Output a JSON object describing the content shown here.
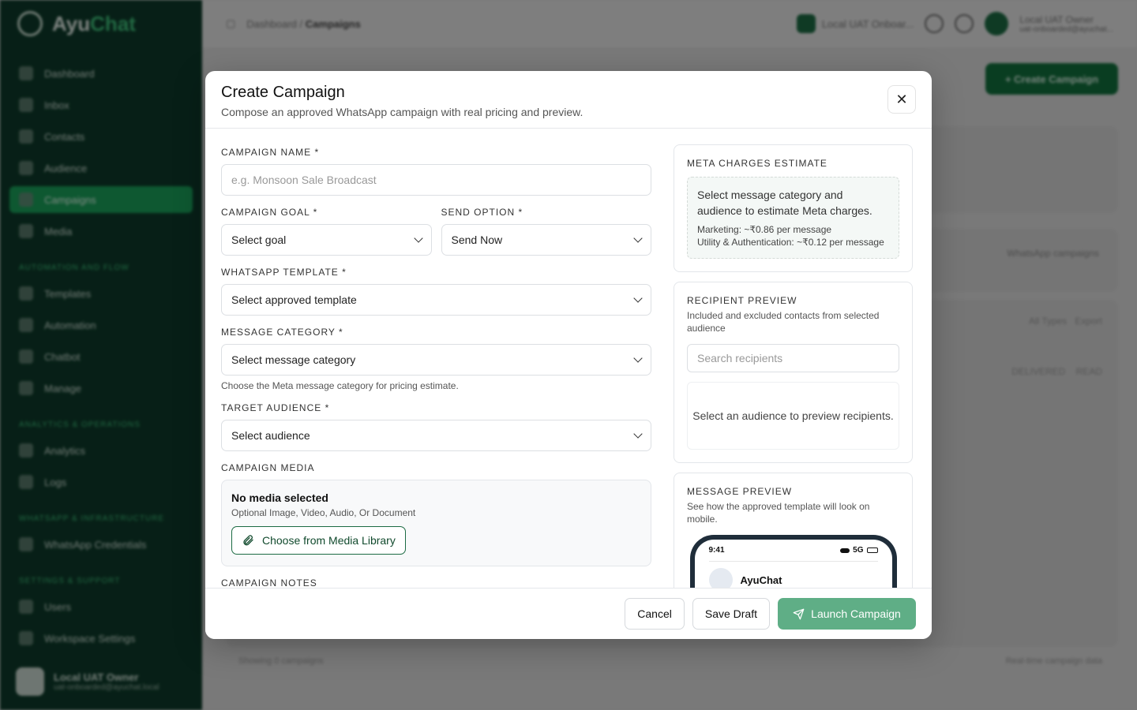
{
  "colors": {
    "brand_dark": "#0d3a2a",
    "accent": "#1aa05a",
    "primary_disabled": "#5fae86"
  },
  "sidebar": {
    "brand_prefix": "Ayu",
    "brand_suffix": "Chat",
    "items": [
      {
        "label": "Dashboard",
        "icon": "grid-icon"
      },
      {
        "label": "Inbox",
        "icon": "chat-icon"
      },
      {
        "label": "Contacts",
        "icon": "contacts-icon"
      },
      {
        "label": "Audience",
        "icon": "globe-icon"
      },
      {
        "label": "Campaigns",
        "icon": "send-icon",
        "active": true
      },
      {
        "label": "Media",
        "icon": "media-icon"
      }
    ],
    "section_automation": "Automation and Flow",
    "items_automation": [
      {
        "label": "Templates"
      },
      {
        "label": "Automation"
      },
      {
        "label": "Chatbot"
      },
      {
        "label": "Manage"
      }
    ],
    "section_analytics": "Analytics & Operations",
    "items_analytics": [
      {
        "label": "Analytics"
      },
      {
        "label": "Logs"
      }
    ],
    "section_whatsapp": "WhatsApp & Infrastructure",
    "items_whatsapp": [
      {
        "label": "WhatsApp Credentials"
      }
    ],
    "section_settings": "Settings & Support",
    "items_settings": [
      {
        "label": "Users"
      },
      {
        "label": "Workspace Settings"
      }
    ],
    "user_name": "Local UAT Owner",
    "user_email": "uat-onboarded@ayuchat.local"
  },
  "topbar": {
    "crumb_1": "Dashboard",
    "crumb_sep": "/",
    "crumb_2": "Campaigns",
    "workspace": "Local UAT Onboar...",
    "user_name": "Local UAT Owner",
    "user_email": "uat-onboarded@ayuchat..."
  },
  "background": {
    "create_button": "+ Create Campaign",
    "whatsapp_campaigns": "WhatsApp campaigns",
    "filter": "All Types",
    "export": "Export",
    "col_delivered": "DELIVERED",
    "col_read": "READ",
    "footer_left": "Showing 0 campaigns",
    "footer_right": "Real-time campaign data"
  },
  "modal": {
    "title": "Create Campaign",
    "subtitle": "Compose an approved WhatsApp campaign with real pricing and preview.",
    "close_glyph": "✕",
    "campaign_name_label": "CAMPAIGN NAME *",
    "campaign_name_placeholder": "e.g. Monsoon Sale Broadcast",
    "goal_label": "CAMPAIGN GOAL *",
    "goal_value": "Select goal",
    "send_label": "SEND OPTION *",
    "send_value": "Send Now",
    "template_label": "WHATSAPP TEMPLATE *",
    "template_value": "Select approved template",
    "category_label": "MESSAGE CATEGORY *",
    "category_value": "Select message category",
    "category_hint": "Choose the Meta message category for pricing estimate.",
    "audience_label": "TARGET AUDIENCE *",
    "audience_value": "Select audience",
    "media_label": "CAMPAIGN MEDIA",
    "media_none": "No media selected",
    "media_hint": "Optional Image, Video, Audio, Or Document",
    "media_button": "Choose from Media Library",
    "notes_label": "CAMPAIGN NOTES",
    "estimate": {
      "title": "META CHARGES ESTIMATE",
      "text": "Select message category and audience to estimate Meta charges.",
      "marketing": "Marketing: ~₹0.86 per message",
      "utility": "Utility & Authentication: ~₹0.12 per message"
    },
    "recipients": {
      "title": "RECIPIENT PREVIEW",
      "subtitle": "Included and excluded contacts from selected audience",
      "search_placeholder": "Search recipients",
      "empty": "Select an audience to preview recipients."
    },
    "preview": {
      "title": "MESSAGE PREVIEW",
      "subtitle": "See how the approved template will look on mobile.",
      "time": "9:41",
      "network": "5G",
      "contact": "AyuChat"
    },
    "footer": {
      "cancel": "Cancel",
      "save_draft": "Save Draft",
      "launch": "Launch Campaign"
    }
  }
}
